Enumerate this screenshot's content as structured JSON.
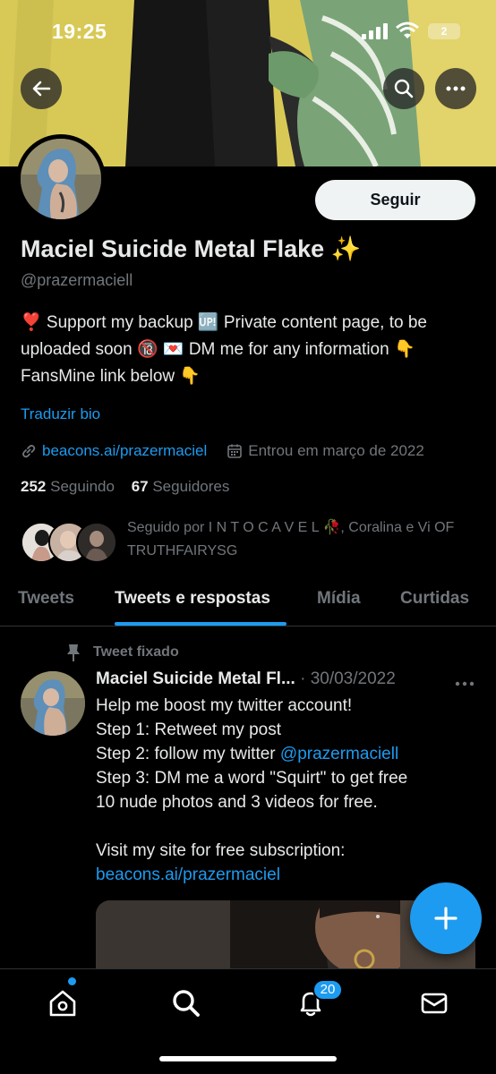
{
  "status_bar": {
    "time": "19:25",
    "battery": "2"
  },
  "profile": {
    "follow_label": "Seguir",
    "display_name": "Maciel Suicide Metal Flake ✨",
    "handle": "@prazermaciell",
    "bio": "❣️ Support my backup 🆙 Private content page, to be uploaded soon 🔞 💌 DM me for any information 👇 FansMine link below 👇",
    "translate_bio": "Traduzir bio",
    "website": "beacons.ai/prazermaciel",
    "joined": "Entrou em março de 2022",
    "following_count": "252",
    "following_label": "Seguindo",
    "followers_count": "67",
    "followers_label": "Seguidores",
    "followed_by": "Seguido por I N T O C A V E L 🥀, Coralina e Vi OF TRUTHFAIRYSG"
  },
  "tabs": [
    {
      "label": "Tweets"
    },
    {
      "label": "Tweets e respostas"
    },
    {
      "label": "Mídia"
    },
    {
      "label": "Curtidas"
    }
  ],
  "active_tab": "Tweets e respostas",
  "pinned_tweet": {
    "pinned_label": "Tweet fixado",
    "author": "Maciel Suicide Metal Fl...",
    "separator": " · ",
    "date": "30/03/2022",
    "lines": {
      "l1": "Help me boost my twitter account!",
      "l2": "Step 1: Retweet my post",
      "l3_prefix": "Step 2: follow my twitter ",
      "l3_mention": "@prazermaciell",
      "l4": "Step 3: DM me a word \"Squirt\" to get free",
      "l5": "10 nude photos and 3 videos for free.",
      "l6": "Visit my site for free subscription:",
      "l7_link": "beacons.ai/prazermaciel"
    }
  },
  "bottom_nav": {
    "notifications_badge": "20"
  },
  "icons": {
    "back": "arrow-left-icon",
    "search": "search-icon",
    "more": "more-horizontal-icon",
    "link": "link-icon",
    "calendar": "calendar-icon",
    "pin": "pin-icon",
    "compose": "plus-icon",
    "home": "home-icon",
    "bell": "bell-icon",
    "mail": "mail-icon"
  },
  "colors": {
    "accent": "#1d9bf0",
    "background": "#000000",
    "text": "#e7e9ea",
    "muted": "#71767b"
  }
}
